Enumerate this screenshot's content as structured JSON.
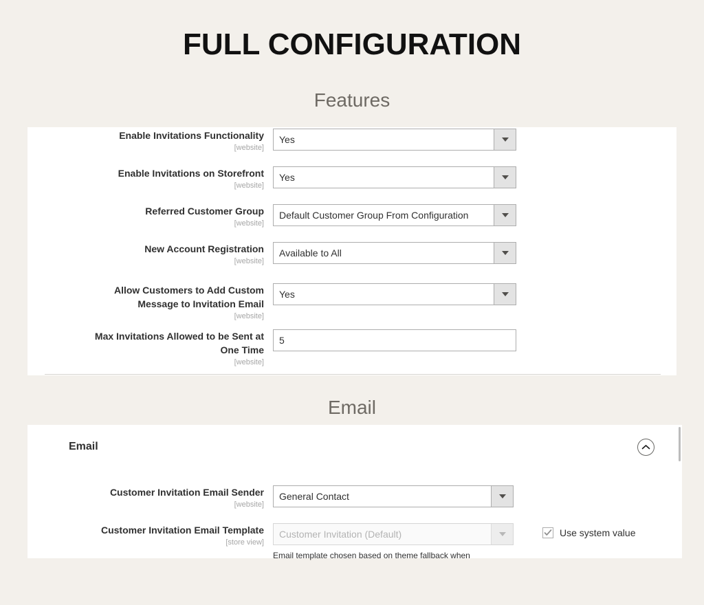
{
  "page": {
    "title": "FULL CONFIGURATION"
  },
  "sections": [
    {
      "heading": "Features",
      "fields": [
        {
          "label": "Enable Invitations Functionality",
          "scope": "[website]",
          "type": "select",
          "value": "Yes"
        },
        {
          "label": "Enable Invitations on Storefront",
          "scope": "[website]",
          "type": "select",
          "value": "Yes"
        },
        {
          "label": "Referred Customer Group",
          "scope": "[website]",
          "type": "select",
          "value": "Default Customer Group From Configuration"
        },
        {
          "label": "New Account Registration",
          "scope": "[website]",
          "type": "select",
          "value": "Available to All"
        },
        {
          "label": "Allow Customers to Add Custom Message to Invitation Email",
          "scope": "[website]",
          "type": "select",
          "value": "Yes"
        },
        {
          "label": "Max Invitations Allowed to be Sent at One Time",
          "scope": "[website]",
          "type": "text",
          "value": "5"
        }
      ]
    },
    {
      "heading": "Email",
      "panel_title": "Email",
      "collapse_icon": "chevron-up-circle-icon",
      "fields": [
        {
          "label": "Customer Invitation Email Sender",
          "scope": "[website]",
          "type": "select",
          "value": "General Contact"
        },
        {
          "label": "Customer Invitation Email Template",
          "scope": "[store view]",
          "type": "select",
          "value": "Customer Invitation (Default)",
          "disabled": true,
          "note": "Email template chosen based on theme fallback when",
          "system_value": {
            "label": "Use system value",
            "checked": true
          }
        }
      ]
    }
  ],
  "colors": {
    "page_background": "#f3f0eb",
    "panel_background": "#ffffff",
    "label_text": "#303030",
    "scope_text": "#a6a6a6",
    "section_heading": "#6e6a64",
    "title_text": "#111111",
    "select_border": "#adadad",
    "select_button": "#e3e3e3"
  }
}
